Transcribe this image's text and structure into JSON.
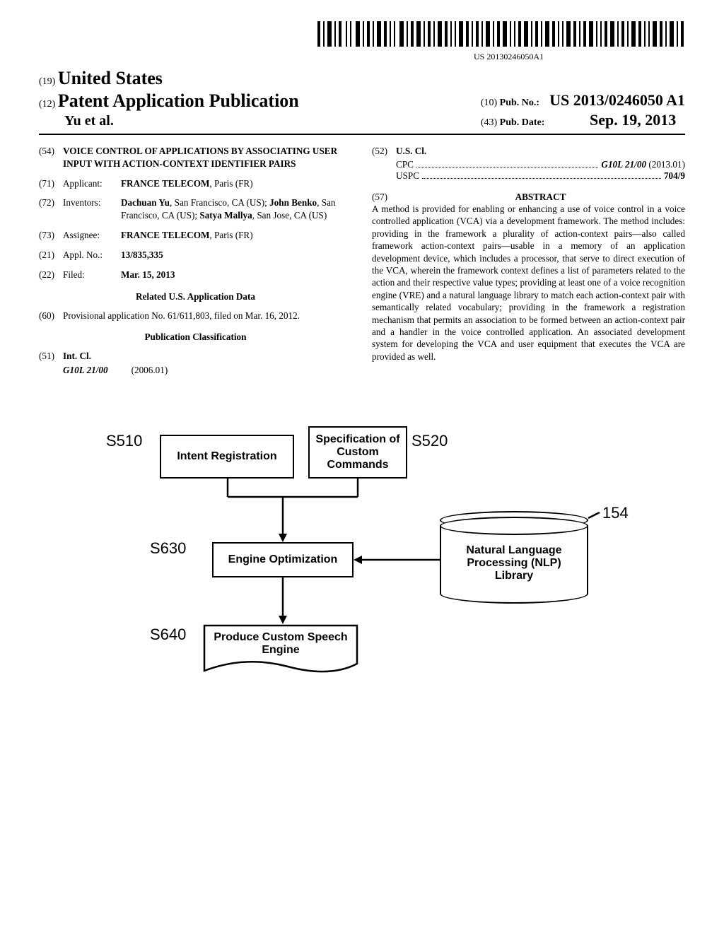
{
  "barcode_label": "US 20130246050A1",
  "header": {
    "country_code": "(19)",
    "country": "United States",
    "pub_type_code": "(12)",
    "pub_type": "Patent Application Publication",
    "authors": "Yu et al.",
    "pubno_code": "(10)",
    "pubno_label": "Pub. No.:",
    "pubno_value": "US 2013/0246050 A1",
    "pubdate_code": "(43)",
    "pubdate_label": "Pub. Date:",
    "pubdate_value": "Sep. 19, 2013"
  },
  "left": {
    "title_code": "(54)",
    "title": "VOICE CONTROL OF APPLICATIONS BY ASSOCIATING USER INPUT WITH ACTION-CONTEXT IDENTIFIER PAIRS",
    "applicant_code": "(71)",
    "applicant_label": "Applicant:",
    "applicant_value_bold": "FRANCE TELECOM",
    "applicant_value_rest": ", Paris (FR)",
    "inventors_code": "(72)",
    "inventors_label": "Inventors:",
    "inventors_value": "Dachuan Yu, San Francisco, CA (US); John Benko, San Francisco, CA (US); Satya Mallya, San Jose, CA (US)",
    "assignee_code": "(73)",
    "assignee_label": "Assignee:",
    "assignee_value_bold": "FRANCE TELECOM",
    "assignee_value_rest": ", Paris (FR)",
    "applno_code": "(21)",
    "applno_label": "Appl. No.:",
    "applno_value": "13/835,335",
    "filed_code": "(22)",
    "filed_label": "Filed:",
    "filed_value": "Mar. 15, 2013",
    "related_head": "Related U.S. Application Data",
    "provisional_code": "(60)",
    "provisional_value": "Provisional application No. 61/611,803, filed on Mar. 16, 2012.",
    "pubclass_head": "Publication Classification",
    "intcl_code": "(51)",
    "intcl_label": "Int. Cl.",
    "intcl_class": "G10L 21/00",
    "intcl_date": "(2006.01)"
  },
  "right": {
    "uscl_code": "(52)",
    "uscl_label": "U.S. Cl.",
    "cpc_lead": "CPC",
    "cpc_trail": "G10L 21/00 (2013.01)",
    "uspc_lead": "USPC",
    "uspc_trail": "704/9",
    "abstract_code": "(57)",
    "abstract_head": "ABSTRACT",
    "abstract_body": "A method is provided for enabling or enhancing a use of voice control in a voice controlled application (VCA) via a development framework. The method includes: providing in the framework a plurality of action-context pairs—also called framework action-context pairs—usable in a memory of an application development device, which includes a processor, that serve to direct execution of the VCA, wherein the framework context defines a list of parameters related to the action and their respective value types; providing at least one of a voice recognition engine (VRE) and a natural language library to match each action-context pair with semantically related vocabulary; providing in the framework a registration mechanism that permits an association to be formed between an action-context pair and a handler in the voice controlled application. An associated development system for developing the VCA and user equipment that executes the VCA are provided as well."
  },
  "figure": {
    "s510": "S510",
    "s520": "S520",
    "s630": "S630",
    "s640": "S640",
    "lbl154": "154",
    "box_intent": "Intent Registration",
    "box_spec": "Specification of Custom Commands",
    "box_engine": "Engine Optimization",
    "box_produce": "Produce Custom Speech Engine",
    "cyl_nlp": "Natural Language Processing (NLP) Library"
  }
}
